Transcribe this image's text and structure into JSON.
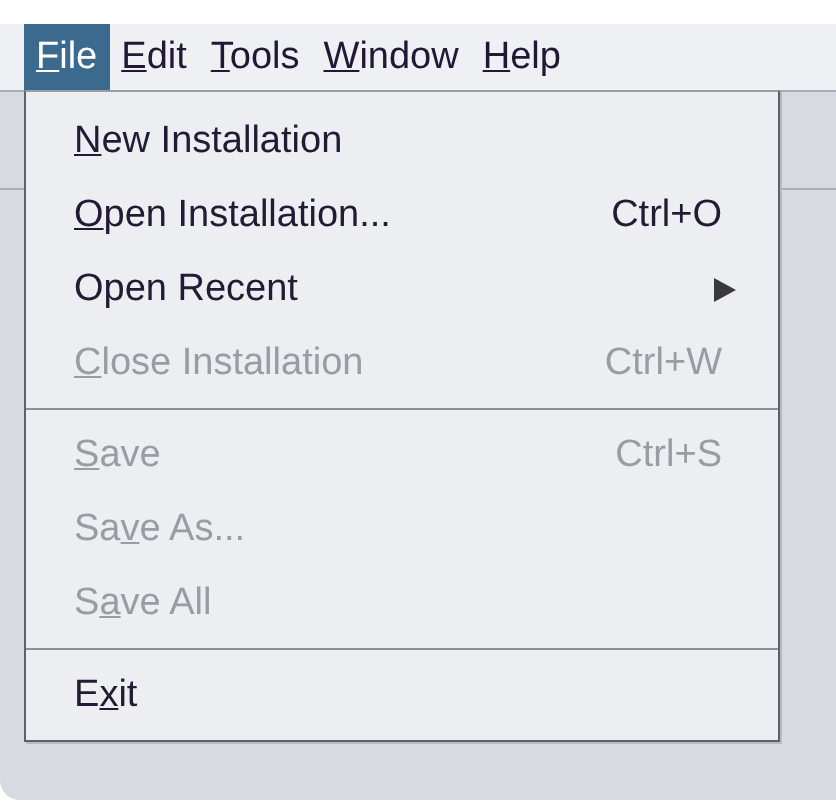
{
  "menubar": [
    {
      "mnemonic": "F",
      "after": "ile",
      "selected": true
    },
    {
      "mnemonic": "E",
      "after": "dit",
      "selected": false
    },
    {
      "mnemonic": "T",
      "after": "ools",
      "selected": false
    },
    {
      "mnemonic": "W",
      "after": "indow",
      "selected": false
    },
    {
      "mnemonic": "H",
      "after": "elp",
      "selected": false
    }
  ],
  "menu": {
    "sections": [
      {
        "items": [
          {
            "mnemonic": "N",
            "after": "ew Installation",
            "disabled": false
          },
          {
            "mnemonic": "O",
            "after": "pen Installation...",
            "shortcut": "Ctrl+O",
            "disabled": false
          },
          {
            "after": "Open Recent",
            "submenu": true,
            "disabled": false
          },
          {
            "mnemonic": "C",
            "after": "lose Installation",
            "shortcut": "Ctrl+W",
            "disabled": true
          }
        ]
      },
      {
        "items": [
          {
            "mnemonic": "S",
            "after": "ave",
            "shortcut": "Ctrl+S",
            "disabled": true
          },
          {
            "before": "Sa",
            "mnemonic": "v",
            "after": "e As...",
            "disabled": true
          },
          {
            "before": "S",
            "mnemonic": "a",
            "after": "ve All",
            "disabled": true
          }
        ]
      },
      {
        "items": [
          {
            "before": "E",
            "mnemonic": "x",
            "after": "it",
            "disabled": false
          }
        ]
      }
    ]
  }
}
